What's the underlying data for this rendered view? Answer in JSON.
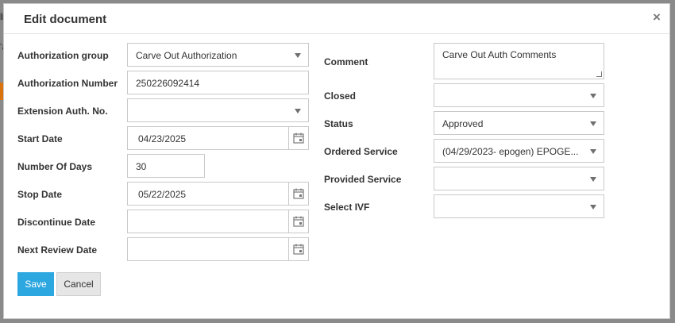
{
  "dialog": {
    "title": "Edit document",
    "close_glyph": "×",
    "save_label": "Save",
    "cancel_label": "Cancel"
  },
  "left_fields": [
    {
      "label": "Authorization group",
      "value": "Carve Out Authorization",
      "control": "select"
    },
    {
      "label": "Authorization Number",
      "value": "250226092414",
      "control": "text"
    },
    {
      "label": "Extension Auth. No.",
      "value": "",
      "control": "select"
    },
    {
      "label": "Start Date",
      "value": "04/23/2025",
      "control": "date"
    },
    {
      "label": "Number Of Days",
      "value": "30",
      "control": "number"
    },
    {
      "label": "Stop Date",
      "value": "05/22/2025",
      "control": "date"
    },
    {
      "label": "Discontinue Date",
      "value": "",
      "control": "date"
    },
    {
      "label": "Next Review Date",
      "value": "",
      "control": "date"
    }
  ],
  "right_fields": [
    {
      "label": "Comment",
      "value": "Carve Out Auth Comments",
      "control": "textarea"
    },
    {
      "label": "Closed",
      "value": "",
      "control": "select"
    },
    {
      "label": "Status",
      "value": "Approved",
      "control": "select"
    },
    {
      "label": "Ordered Service",
      "value": "(04/29/2023- epogen) EPOGE...",
      "control": "select"
    },
    {
      "label": "Provided Service",
      "value": "",
      "control": "select"
    },
    {
      "label": "Select IVF",
      "value": "",
      "control": "select"
    }
  ],
  "icons": {
    "close": "close-icon",
    "dropdown": "chevron-down-icon",
    "calendar": "calendar-icon"
  },
  "colors": {
    "save_button": "#2da7e0",
    "cancel_button": "#e6e6e6",
    "overlay": "#8a8a8a"
  }
}
